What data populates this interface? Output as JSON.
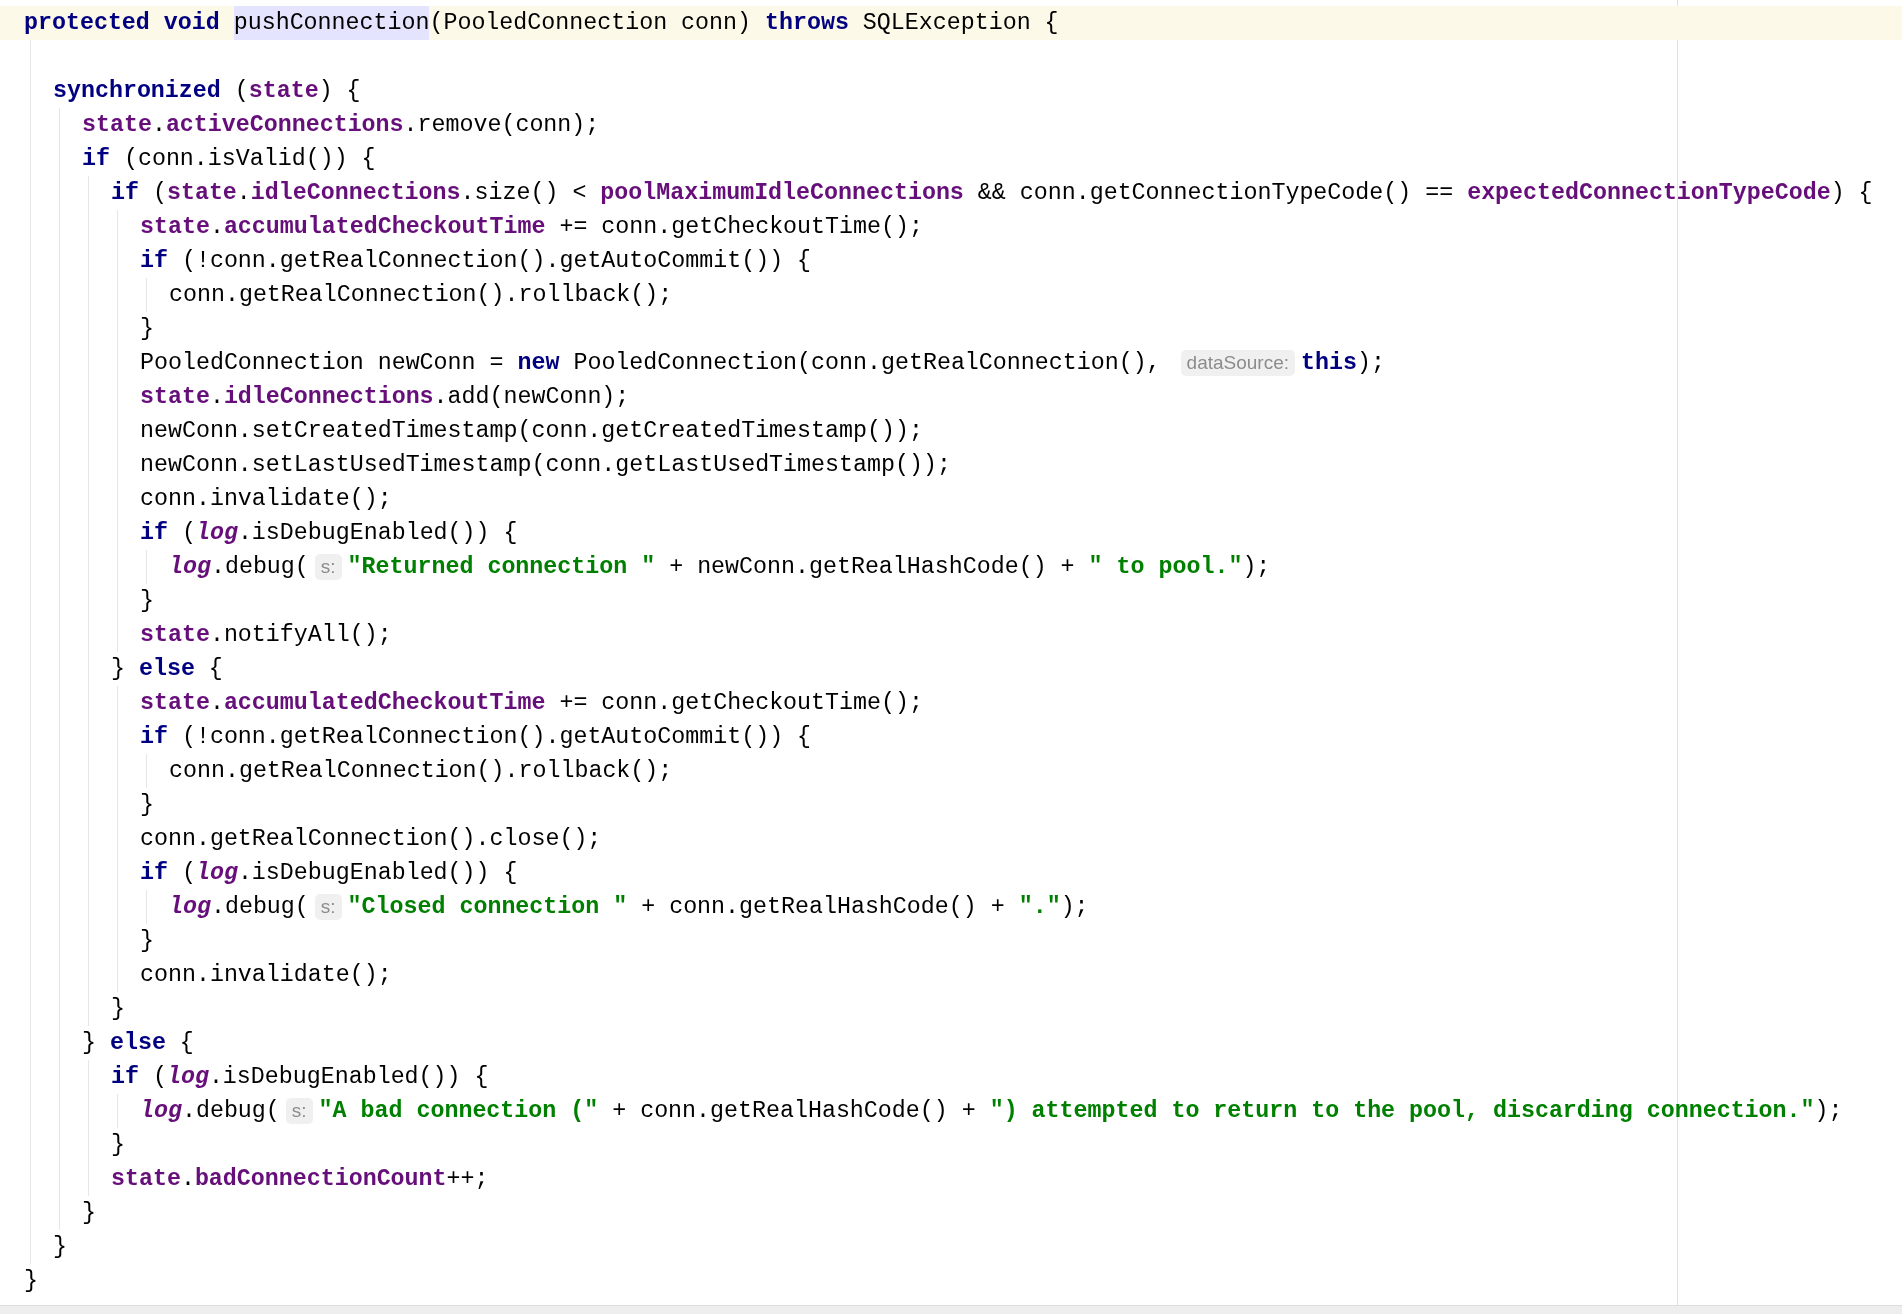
{
  "editor": {
    "lines": [
      {
        "current": true,
        "tokens": [
          {
            "kind": "keyword",
            "text": "protected void "
          },
          {
            "kind": "usage",
            "text": "pushConnection"
          },
          {
            "kind": "plain",
            "text": "(PooledConnection conn) "
          },
          {
            "kind": "keyword",
            "text": "throws"
          },
          {
            "kind": "plain",
            "text": " SQLException {"
          }
        ],
        "children": [
          {
            "kind": "blank"
          },
          {
            "tokens": [
              {
                "kind": "keyword",
                "text": "synchronized"
              },
              {
                "kind": "plain",
                "text": " ("
              },
              {
                "kind": "field",
                "text": "state"
              },
              {
                "kind": "plain",
                "text": ") {"
              }
            ],
            "children": [
              {
                "tokens": [
                  {
                    "kind": "field",
                    "text": "state"
                  },
                  {
                    "kind": "plain",
                    "text": "."
                  },
                  {
                    "kind": "field",
                    "text": "activeConnections"
                  },
                  {
                    "kind": "plain",
                    "text": ".remove(conn);"
                  }
                ]
              },
              {
                "tokens": [
                  {
                    "kind": "keyword",
                    "text": "if"
                  },
                  {
                    "kind": "plain",
                    "text": " (conn.isValid()) {"
                  }
                ],
                "children": [
                  {
                    "tokens": [
                      {
                        "kind": "keyword",
                        "text": "if"
                      },
                      {
                        "kind": "plain",
                        "text": " ("
                      },
                      {
                        "kind": "field",
                        "text": "state"
                      },
                      {
                        "kind": "plain",
                        "text": "."
                      },
                      {
                        "kind": "field",
                        "text": "idleConnections"
                      },
                      {
                        "kind": "plain",
                        "text": ".size() < "
                      },
                      {
                        "kind": "field",
                        "text": "poolMaximumIdleConnections"
                      },
                      {
                        "kind": "plain",
                        "text": " && conn.getConnectionTypeCode() == "
                      },
                      {
                        "kind": "field",
                        "text": "expectedConnectionTypeCode"
                      },
                      {
                        "kind": "plain",
                        "text": ") {"
                      }
                    ],
                    "children": [
                      {
                        "tokens": [
                          {
                            "kind": "field",
                            "text": "state"
                          },
                          {
                            "kind": "plain",
                            "text": "."
                          },
                          {
                            "kind": "field",
                            "text": "accumulatedCheckoutTime"
                          },
                          {
                            "kind": "plain",
                            "text": " += conn.getCheckoutTime();"
                          }
                        ]
                      },
                      {
                        "tokens": [
                          {
                            "kind": "keyword",
                            "text": "if"
                          },
                          {
                            "kind": "plain",
                            "text": " (!conn.getRealConnection().getAutoCommit()) {"
                          }
                        ],
                        "children": [
                          {
                            "tokens": [
                              {
                                "kind": "plain",
                                "text": "conn.getRealConnection().rollback();"
                              }
                            ]
                          }
                        ]
                      },
                      {
                        "tokens": [
                          {
                            "kind": "plain",
                            "text": "}"
                          }
                        ]
                      },
                      {
                        "tokens": [
                          {
                            "kind": "plain",
                            "text": "PooledConnection newConn = "
                          },
                          {
                            "kind": "keyword",
                            "text": "new"
                          },
                          {
                            "kind": "plain",
                            "text": " PooledConnection(conn.getRealConnection(), "
                          },
                          {
                            "kind": "hint",
                            "text": "dataSource:"
                          },
                          {
                            "kind": "keyword",
                            "text": "this"
                          },
                          {
                            "kind": "plain",
                            "text": ");"
                          }
                        ]
                      },
                      {
                        "tokens": [
                          {
                            "kind": "field",
                            "text": "state"
                          },
                          {
                            "kind": "plain",
                            "text": "."
                          },
                          {
                            "kind": "field",
                            "text": "idleConnections"
                          },
                          {
                            "kind": "plain",
                            "text": ".add(newConn);"
                          }
                        ]
                      },
                      {
                        "tokens": [
                          {
                            "kind": "plain",
                            "text": "newConn.setCreatedTimestamp(conn.getCreatedTimestamp());"
                          }
                        ]
                      },
                      {
                        "tokens": [
                          {
                            "kind": "plain",
                            "text": "newConn.setLastUsedTimestamp(conn.getLastUsedTimestamp());"
                          }
                        ]
                      },
                      {
                        "tokens": [
                          {
                            "kind": "plain",
                            "text": "conn.invalidate();"
                          }
                        ]
                      },
                      {
                        "tokens": [
                          {
                            "kind": "keyword",
                            "text": "if"
                          },
                          {
                            "kind": "plain",
                            "text": " ("
                          },
                          {
                            "kind": "static",
                            "text": "log"
                          },
                          {
                            "kind": "plain",
                            "text": ".isDebugEnabled()) {"
                          }
                        ],
                        "children": [
                          {
                            "tokens": [
                              {
                                "kind": "static",
                                "text": "log"
                              },
                              {
                                "kind": "plain",
                                "text": ".debug("
                              },
                              {
                                "kind": "hint",
                                "text": "s:"
                              },
                              {
                                "kind": "string",
                                "text": "\"Returned connection \""
                              },
                              {
                                "kind": "plain",
                                "text": " + newConn.getRealHashCode() + "
                              },
                              {
                                "kind": "string",
                                "text": "\" to pool.\""
                              },
                              {
                                "kind": "plain",
                                "text": ");"
                              }
                            ]
                          }
                        ]
                      },
                      {
                        "tokens": [
                          {
                            "kind": "plain",
                            "text": "}"
                          }
                        ]
                      },
                      {
                        "tokens": [
                          {
                            "kind": "field",
                            "text": "state"
                          },
                          {
                            "kind": "plain",
                            "text": ".notifyAll();"
                          }
                        ]
                      }
                    ]
                  },
                  {
                    "tokens": [
                      {
                        "kind": "plain",
                        "text": "} "
                      },
                      {
                        "kind": "keyword",
                        "text": "else"
                      },
                      {
                        "kind": "plain",
                        "text": " {"
                      }
                    ],
                    "children": [
                      {
                        "tokens": [
                          {
                            "kind": "field",
                            "text": "state"
                          },
                          {
                            "kind": "plain",
                            "text": "."
                          },
                          {
                            "kind": "field",
                            "text": "accumulatedCheckoutTime"
                          },
                          {
                            "kind": "plain",
                            "text": " += conn.getCheckoutTime();"
                          }
                        ]
                      },
                      {
                        "tokens": [
                          {
                            "kind": "keyword",
                            "text": "if"
                          },
                          {
                            "kind": "plain",
                            "text": " (!conn.getRealConnection().getAutoCommit()) {"
                          }
                        ],
                        "children": [
                          {
                            "tokens": [
                              {
                                "kind": "plain",
                                "text": "conn.getRealConnection().rollback();"
                              }
                            ]
                          }
                        ]
                      },
                      {
                        "tokens": [
                          {
                            "kind": "plain",
                            "text": "}"
                          }
                        ]
                      },
                      {
                        "tokens": [
                          {
                            "kind": "plain",
                            "text": "conn.getRealConnection().close();"
                          }
                        ]
                      },
                      {
                        "tokens": [
                          {
                            "kind": "keyword",
                            "text": "if"
                          },
                          {
                            "kind": "plain",
                            "text": " ("
                          },
                          {
                            "kind": "static",
                            "text": "log"
                          },
                          {
                            "kind": "plain",
                            "text": ".isDebugEnabled()) {"
                          }
                        ],
                        "children": [
                          {
                            "tokens": [
                              {
                                "kind": "static",
                                "text": "log"
                              },
                              {
                                "kind": "plain",
                                "text": ".debug("
                              },
                              {
                                "kind": "hint",
                                "text": "s:"
                              },
                              {
                                "kind": "string",
                                "text": "\"Closed connection \""
                              },
                              {
                                "kind": "plain",
                                "text": " + conn.getRealHashCode() + "
                              },
                              {
                                "kind": "string",
                                "text": "\".\""
                              },
                              {
                                "kind": "plain",
                                "text": ");"
                              }
                            ]
                          }
                        ]
                      },
                      {
                        "tokens": [
                          {
                            "kind": "plain",
                            "text": "}"
                          }
                        ]
                      },
                      {
                        "tokens": [
                          {
                            "kind": "plain",
                            "text": "conn.invalidate();"
                          }
                        ]
                      }
                    ]
                  },
                  {
                    "tokens": [
                      {
                        "kind": "plain",
                        "text": "}"
                      }
                    ]
                  }
                ]
              },
              {
                "tokens": [
                  {
                    "kind": "plain",
                    "text": "} "
                  },
                  {
                    "kind": "keyword",
                    "text": "else"
                  },
                  {
                    "kind": "plain",
                    "text": " {"
                  }
                ],
                "children": [
                  {
                    "tokens": [
                      {
                        "kind": "keyword",
                        "text": "if"
                      },
                      {
                        "kind": "plain",
                        "text": " ("
                      },
                      {
                        "kind": "static",
                        "text": "log"
                      },
                      {
                        "kind": "plain",
                        "text": ".isDebugEnabled()) {"
                      }
                    ],
                    "children": [
                      {
                        "tokens": [
                          {
                            "kind": "static",
                            "text": "log"
                          },
                          {
                            "kind": "plain",
                            "text": ".debug("
                          },
                          {
                            "kind": "hint",
                            "text": "s:"
                          },
                          {
                            "kind": "string",
                            "text": "\"A bad connection (\""
                          },
                          {
                            "kind": "plain",
                            "text": " + conn.getRealHashCode() + "
                          },
                          {
                            "kind": "string",
                            "text": "\") attempted to return to the pool, discarding connection.\""
                          },
                          {
                            "kind": "plain",
                            "text": ");"
                          }
                        ]
                      }
                    ]
                  },
                  {
                    "tokens": [
                      {
                        "kind": "plain",
                        "text": "}"
                      }
                    ]
                  },
                  {
                    "tokens": [
                      {
                        "kind": "field",
                        "text": "state"
                      },
                      {
                        "kind": "plain",
                        "text": "."
                      },
                      {
                        "kind": "field",
                        "text": "badConnectionCount"
                      },
                      {
                        "kind": "plain",
                        "text": "++;"
                      }
                    ]
                  }
                ]
              },
              {
                "tokens": [
                  {
                    "kind": "plain",
                    "text": "}"
                  }
                ]
              }
            ]
          },
          {
            "tokens": [
              {
                "kind": "plain",
                "text": "}"
              }
            ]
          }
        ]
      },
      {
        "tokens": [
          {
            "kind": "plain",
            "text": "}"
          }
        ]
      }
    ]
  }
}
